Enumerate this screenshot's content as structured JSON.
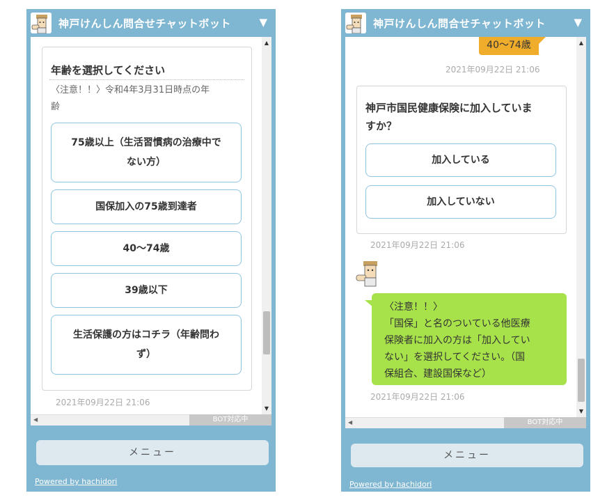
{
  "widget": {
    "title": "神戸けんしん問合せチャットボット",
    "toggle_icon": "▼",
    "status_badge": "BOT対応中",
    "menu_label": "メニュー",
    "powered_by": "Powered by hachidori",
    "colors": {
      "frame": "#7fb6d1",
      "user_bubble": "#f0ad2b",
      "bot_bubble": "#a8e24a",
      "option_border": "#8ec5e2"
    }
  },
  "left_panel": {
    "question": "年齢を選択してください",
    "note_line1": "〈注意！！〉令和4年3月31日時点の年",
    "note_line2": "齢",
    "options": [
      {
        "line1": "75歳以上（生活習慣病の治療中で",
        "line2": "ない方）"
      },
      {
        "line1": "国保加入の75歳到達者"
      },
      {
        "line1": "40〜74歳"
      },
      {
        "line1": "39歳以下"
      },
      {
        "line1": "生活保護の方はコチラ（年齢問わ",
        "line2": "ず）"
      }
    ],
    "timestamp": "2021年09月22日 21:06"
  },
  "right_panel": {
    "user_reply": "40〜74歳",
    "user_reply_timestamp": "2021年09月22日 21:06",
    "question_line1": "神戸市国民健康保険に加入していま",
    "question_line2": "すか？",
    "options": [
      {
        "line1": "加入している"
      },
      {
        "line1": "加入していない"
      }
    ],
    "question_timestamp": "2021年09月22日 21:06",
    "bot_message": [
      "〈注意！！〉",
      "「国保」と名のついている他医療",
      "保険者に加入の方は「加入してい",
      "ない」を選択してください。（国",
      "保組合、建設国保など）"
    ],
    "bot_message_timestamp": "2021年09月22日 21:06"
  }
}
